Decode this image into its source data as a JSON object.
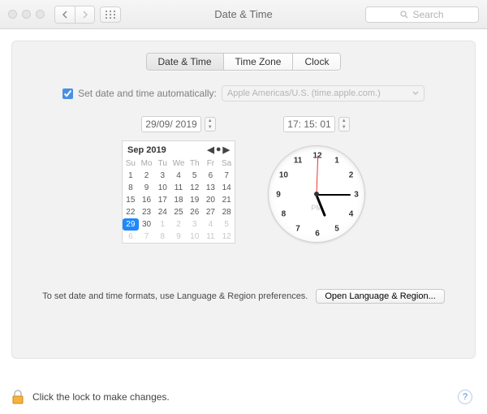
{
  "window": {
    "title": "Date & Time",
    "search_placeholder": "Search"
  },
  "tabs": [
    "Date & Time",
    "Time Zone",
    "Clock"
  ],
  "active_tab_index": 0,
  "auto": {
    "checkbox_checked": true,
    "label": "Set date and time automatically:",
    "server": "Apple Americas/U.S. (time.apple.com.)"
  },
  "date_field": "29/09/ 2019",
  "time_field": "17: 15: 01",
  "calendar": {
    "month_label": "Sep 2019",
    "dow": [
      "Su",
      "Mo",
      "Tu",
      "We",
      "Th",
      "Fr",
      "Sa"
    ],
    "leading_blanks": [
      1,
      2,
      3,
      4,
      5,
      6,
      7
    ],
    "days": [
      1,
      2,
      3,
      4,
      5,
      6,
      7,
      8,
      9,
      10,
      11,
      12,
      13,
      14,
      15,
      16,
      17,
      18,
      19,
      20,
      21,
      22,
      23,
      24,
      25,
      26,
      27,
      28,
      29,
      30
    ],
    "trailing": [
      1,
      2,
      3,
      4,
      5,
      6,
      7,
      8,
      9,
      10,
      11,
      12
    ],
    "selected_day": 29
  },
  "clock": {
    "ampm": "PM",
    "hour_angle": 68,
    "minute_angle": 0,
    "second_angle": -88
  },
  "hint": "To set date and time formats, use Language & Region preferences.",
  "open_lr_button": "Open Language & Region...",
  "lock_text": "Click the lock to make changes.",
  "help_glyph": "?"
}
